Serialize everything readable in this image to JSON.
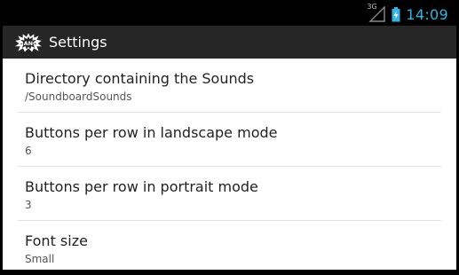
{
  "status_bar": {
    "network_type": "3G",
    "time": "14:09",
    "clock_color": "#33b5e5"
  },
  "action_bar": {
    "title": "Settings",
    "icon": "bang-app-icon"
  },
  "preferences": [
    {
      "title": "Directory containing the Sounds",
      "summary": "/SoundboardSounds"
    },
    {
      "title": "Buttons per row in landscape mode",
      "summary": "6"
    },
    {
      "title": "Buttons per row in portrait mode",
      "summary": "3"
    },
    {
      "title": "Font size",
      "summary": "Small"
    }
  ]
}
